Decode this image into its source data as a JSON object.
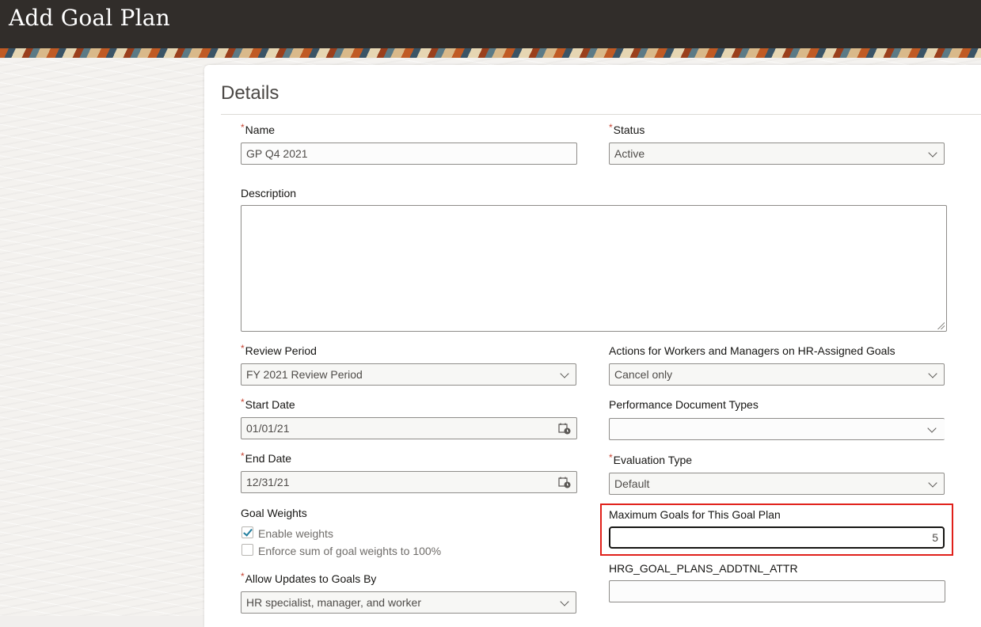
{
  "page": {
    "title": "Add Goal Plan"
  },
  "section": {
    "title": "Details"
  },
  "fields": {
    "name": {
      "label": "Name",
      "required_mark": "*",
      "value": "GP Q4 2021"
    },
    "status": {
      "label": "Status",
      "required_mark": "*",
      "value": "Active"
    },
    "description": {
      "label": "Description",
      "value": ""
    },
    "review_period": {
      "label": "Review Period",
      "required_mark": "*",
      "value": "FY 2021 Review Period"
    },
    "actions": {
      "label": "Actions for Workers and Managers on HR-Assigned Goals",
      "value": "Cancel only"
    },
    "start_date": {
      "label": "Start Date",
      "required_mark": "*",
      "value": "01/01/21"
    },
    "perf_doc_types": {
      "label": "Performance Document Types",
      "value": ""
    },
    "end_date": {
      "label": "End Date",
      "required_mark": "*",
      "value": "12/31/21"
    },
    "evaluation_type": {
      "label": "Evaluation Type",
      "required_mark": "*",
      "value": "Default"
    },
    "goal_weights": {
      "label": "Goal Weights",
      "enable_weights": {
        "label": "Enable weights",
        "checked": true
      },
      "enforce_sum": {
        "label": "Enforce sum of goal weights to 100%",
        "checked": false
      }
    },
    "max_goals": {
      "label": "Maximum Goals for This Goal Plan",
      "value": "5"
    },
    "allow_updates": {
      "label": "Allow Updates to Goals By",
      "required_mark": "*",
      "value": "HR specialist, manager, and worker"
    },
    "addtnl_attr": {
      "label": "HRG_GOAL_PLANS_ADDTNL_ATTR",
      "value": ""
    }
  },
  "colors": {
    "header_bg": "#312d2a",
    "highlight": "#e0201a",
    "required": "#c74634",
    "check": "#227e9e"
  },
  "icons": [
    "chevron-down-icon",
    "calendar-icon",
    "checkmark-icon",
    "resize-grip-icon"
  ]
}
